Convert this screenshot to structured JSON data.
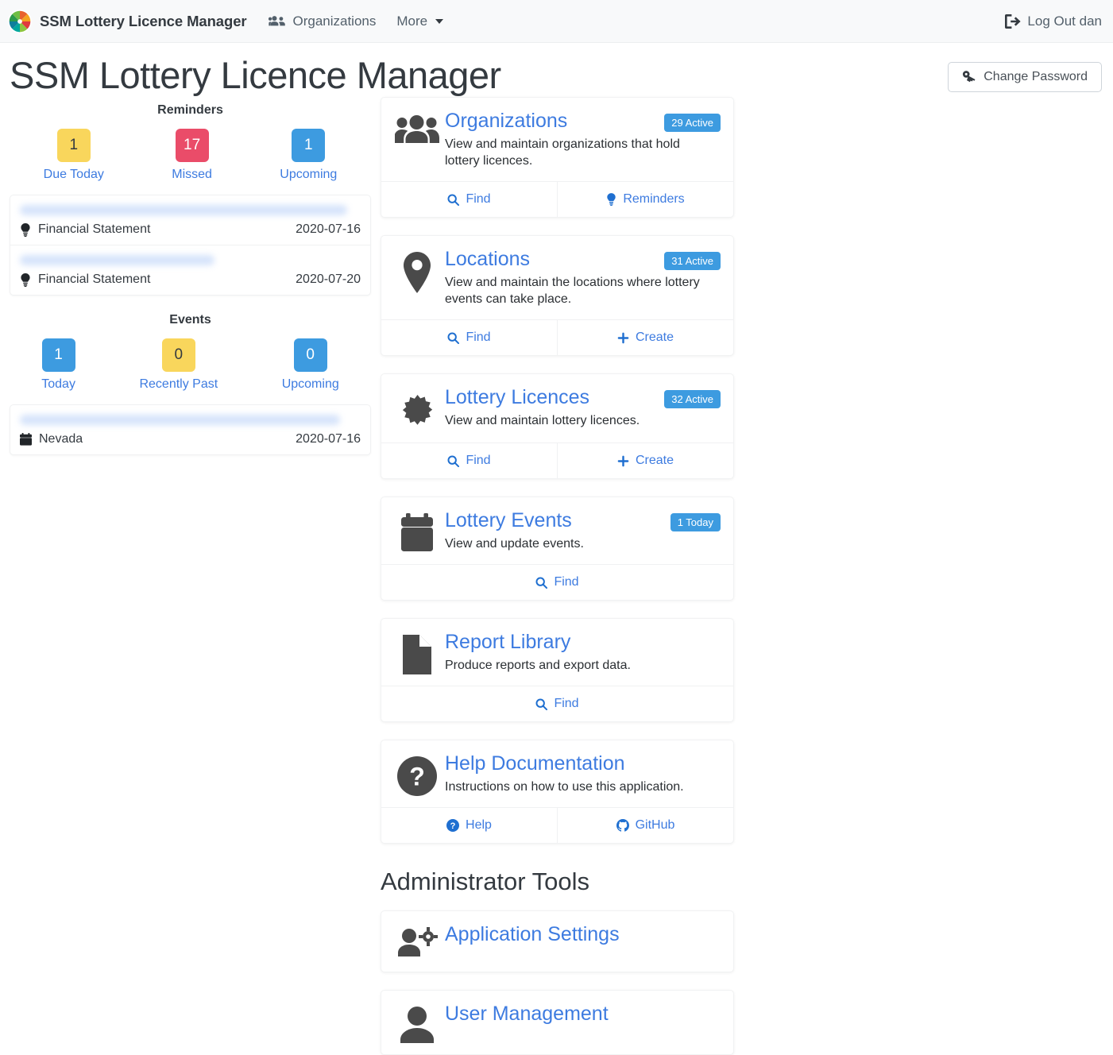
{
  "navbar": {
    "logo_icon": "pinwheel-logo-icon",
    "brand": "SSM Lottery Licence Manager",
    "links": [
      {
        "label": "Organizations",
        "icon": "users-icon"
      },
      {
        "label": "More",
        "icon": "chevron-down-icon"
      }
    ],
    "logout": {
      "label": "Log Out dan",
      "icon": "sign-out-icon"
    }
  },
  "header": {
    "title": "SSM Lottery Licence Manager",
    "change_password": {
      "label": "Change Password",
      "icon": "key-icon"
    }
  },
  "reminders": {
    "title": "Reminders",
    "counters": [
      {
        "value": "1",
        "label": "Due Today",
        "color": "#f9d65c",
        "text_color": "#343a40"
      },
      {
        "value": "17",
        "label": "Missed",
        "color": "#ea4c69",
        "text_color": "#ffffff"
      },
      {
        "value": "1",
        "label": "Upcoming",
        "color": "#3d9be0",
        "text_color": "#ffffff"
      }
    ],
    "items": [
      {
        "org": "",
        "icon": "lightbulb-icon",
        "name": "Financial Statement",
        "date": "2020-07-16"
      },
      {
        "org": "",
        "icon": "lightbulb-icon",
        "name": "Financial Statement",
        "date": "2020-07-20"
      }
    ]
  },
  "events": {
    "title": "Events",
    "counters": [
      {
        "value": "1",
        "label": "Today",
        "color": "#3d9be0",
        "text_color": "#ffffff"
      },
      {
        "value": "0",
        "label": "Recently Past",
        "color": "#f9d65c",
        "text_color": "#343a40"
      },
      {
        "value": "0",
        "label": "Upcoming",
        "color": "#3d9be0",
        "text_color": "#ffffff"
      }
    ],
    "items": [
      {
        "org": "",
        "icon": "calendar-icon",
        "name": "Nevada",
        "date": "2020-07-16"
      }
    ]
  },
  "cards": [
    {
      "key": "organizations",
      "icon": "users-group-icon",
      "title": "Organizations",
      "badge": "29 Active",
      "description": "View and maintain organizations that hold lottery licences.",
      "actions": [
        {
          "label": "Find",
          "icon": "search-icon"
        },
        {
          "label": "Reminders",
          "icon": "lightbulb-icon"
        }
      ]
    },
    {
      "key": "locations",
      "icon": "map-pin-icon",
      "title": "Locations",
      "badge": "31 Active",
      "description": "View and maintain the locations where lottery events can take place.",
      "actions": [
        {
          "label": "Find",
          "icon": "search-icon"
        },
        {
          "label": "Create",
          "icon": "plus-icon"
        }
      ]
    },
    {
      "key": "lottery-licences",
      "icon": "certificate-icon",
      "title": "Lottery Licences",
      "badge": "32 Active",
      "description": "View and maintain lottery licences.",
      "actions": [
        {
          "label": "Find",
          "icon": "search-icon"
        },
        {
          "label": "Create",
          "icon": "plus-icon"
        }
      ]
    },
    {
      "key": "lottery-events",
      "icon": "calendar-icon",
      "title": "Lottery Events",
      "badge": "1 Today",
      "description": "View and update events.",
      "actions": [
        {
          "label": "Find",
          "icon": "search-icon"
        }
      ]
    },
    {
      "key": "report-library",
      "icon": "file-icon",
      "title": "Report Library",
      "badge": "",
      "description": "Produce reports and export data.",
      "actions": [
        {
          "label": "Find",
          "icon": "search-icon"
        }
      ]
    },
    {
      "key": "help-documentation",
      "icon": "question-circle-icon",
      "title": "Help Documentation",
      "badge": "",
      "description": "Instructions on how to use this application.",
      "actions": [
        {
          "label": "Help",
          "icon": "question-circle-icon"
        },
        {
          "label": "GitHub",
          "icon": "github-icon"
        }
      ]
    }
  ],
  "admin": {
    "section_title": "Administrator Tools",
    "cards": [
      {
        "key": "application-settings",
        "icon": "users-cog-icon",
        "title": "Application Settings"
      },
      {
        "key": "user-management",
        "icon": "user-icon",
        "title": "User Management"
      }
    ]
  }
}
